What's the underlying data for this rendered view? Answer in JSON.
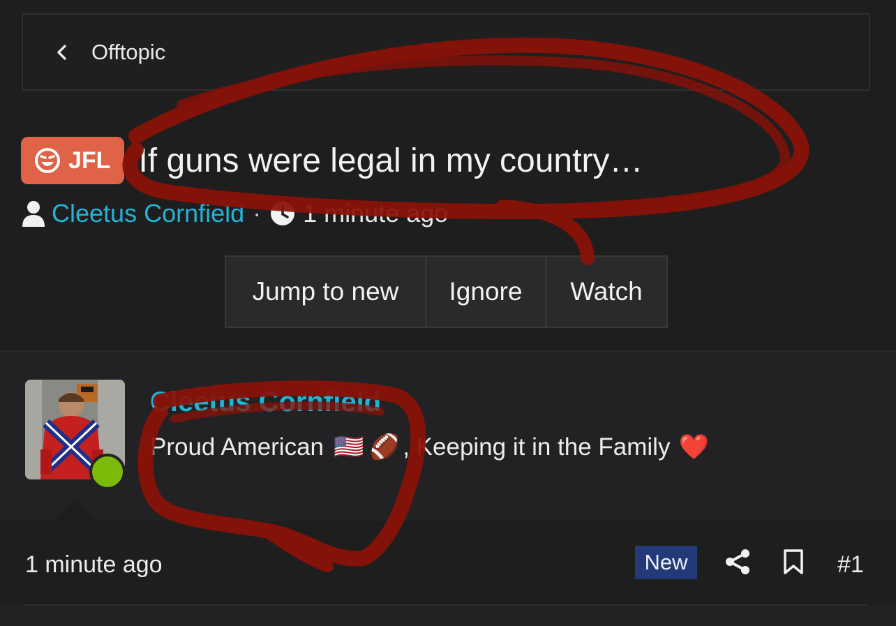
{
  "breadcrumb": {
    "label": "Offtopic",
    "icon": "chevron-left-icon"
  },
  "thread": {
    "prefix": "JFL",
    "prefix_color": "#e06347",
    "title": "If guns were legal in my country…",
    "author": "Cleetus Cornfield",
    "separator": "·",
    "time": "1 minute ago"
  },
  "actions": {
    "jump_to_new": "Jump to new",
    "ignore": "Ignore",
    "watch": "Watch"
  },
  "post": {
    "username": "Cleetus Cornfield",
    "user_title_text": "Proud American",
    "user_title_emojis": [
      "🇺🇸",
      "🏈"
    ],
    "user_title_rest": ", Keeping it in the Family",
    "heart_emoji": "❤️",
    "online_color": "#7cba0a",
    "time": "1 minute ago",
    "badge": "New",
    "post_number": "#1"
  },
  "colors": {
    "accent": "#22b3d6",
    "background": "#1e1e1f",
    "annotation": "#8b1208"
  }
}
